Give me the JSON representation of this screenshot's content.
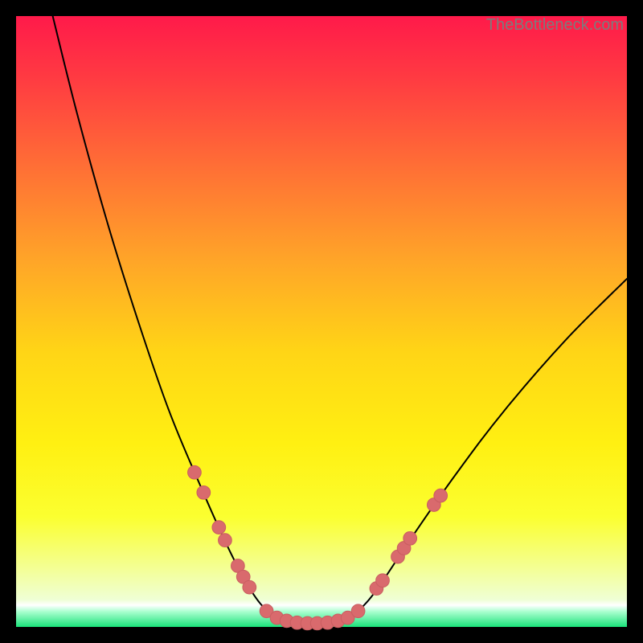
{
  "watermark": "TheBottleneck.com",
  "colors": {
    "frame": "#000000",
    "curve": "#000000",
    "marker_fill": "#d96a6d",
    "marker_stroke": "#c95e61",
    "bottom_band": "#1ae27a"
  },
  "gradient_stops": [
    {
      "offset": 0.0,
      "color": "#ff1a4a"
    },
    {
      "offset": 0.1,
      "color": "#ff3a42"
    },
    {
      "offset": 0.25,
      "color": "#ff7035"
    },
    {
      "offset": 0.4,
      "color": "#ffa528"
    },
    {
      "offset": 0.55,
      "color": "#ffd516"
    },
    {
      "offset": 0.7,
      "color": "#fff012"
    },
    {
      "offset": 0.82,
      "color": "#fbff30"
    },
    {
      "offset": 0.9,
      "color": "#f4ff90"
    },
    {
      "offset": 0.955,
      "color": "#efffd5"
    },
    {
      "offset": 0.965,
      "color": "#ffffff"
    },
    {
      "offset": 0.975,
      "color": "#a9ffcf"
    },
    {
      "offset": 1.0,
      "color": "#1ae27a"
    }
  ],
  "chart_data": {
    "type": "line",
    "title": "",
    "xlabel": "",
    "ylabel": "",
    "x_range": [
      0,
      100
    ],
    "y_range": [
      0,
      100
    ],
    "grid": false,
    "legend": false,
    "series": [
      {
        "name": "bottleneck-curve",
        "points": [
          {
            "x": 6.0,
            "y": 100.0
          },
          {
            "x": 10.0,
            "y": 84.0
          },
          {
            "x": 15.0,
            "y": 66.0
          },
          {
            "x": 20.0,
            "y": 50.0
          },
          {
            "x": 25.0,
            "y": 35.5
          },
          {
            "x": 30.0,
            "y": 23.5
          },
          {
            "x": 34.0,
            "y": 14.5
          },
          {
            "x": 37.0,
            "y": 8.5
          },
          {
            "x": 40.0,
            "y": 3.8
          },
          {
            "x": 43.0,
            "y": 1.3
          },
          {
            "x": 46.0,
            "y": 0.6
          },
          {
            "x": 50.0,
            "y": 0.6
          },
          {
            "x": 54.0,
            "y": 1.3
          },
          {
            "x": 57.0,
            "y": 3.6
          },
          {
            "x": 60.0,
            "y": 7.5
          },
          {
            "x": 65.0,
            "y": 15.0
          },
          {
            "x": 72.0,
            "y": 25.0
          },
          {
            "x": 80.0,
            "y": 35.5
          },
          {
            "x": 90.0,
            "y": 47.0
          },
          {
            "x": 100.0,
            "y": 57.0
          }
        ]
      }
    ],
    "markers": [
      {
        "x": 29.2,
        "y": 25.3
      },
      {
        "x": 30.7,
        "y": 22.0
      },
      {
        "x": 33.2,
        "y": 16.3
      },
      {
        "x": 34.2,
        "y": 14.2
      },
      {
        "x": 36.3,
        "y": 10.0
      },
      {
        "x": 37.2,
        "y": 8.2
      },
      {
        "x": 38.2,
        "y": 6.5
      },
      {
        "x": 41.0,
        "y": 2.6
      },
      {
        "x": 42.7,
        "y": 1.5
      },
      {
        "x": 44.3,
        "y": 1.0
      },
      {
        "x": 46.0,
        "y": 0.7
      },
      {
        "x": 47.7,
        "y": 0.6
      },
      {
        "x": 49.3,
        "y": 0.6
      },
      {
        "x": 51.0,
        "y": 0.7
      },
      {
        "x": 52.7,
        "y": 1.0
      },
      {
        "x": 54.3,
        "y": 1.5
      },
      {
        "x": 56.0,
        "y": 2.6
      },
      {
        "x": 59.0,
        "y": 6.3
      },
      {
        "x": 60.0,
        "y": 7.6
      },
      {
        "x": 62.5,
        "y": 11.5
      },
      {
        "x": 63.5,
        "y": 12.9
      },
      {
        "x": 64.5,
        "y": 14.5
      },
      {
        "x": 68.4,
        "y": 20.0
      },
      {
        "x": 69.5,
        "y": 21.5
      }
    ],
    "marker_radius_pct": 1.1
  }
}
